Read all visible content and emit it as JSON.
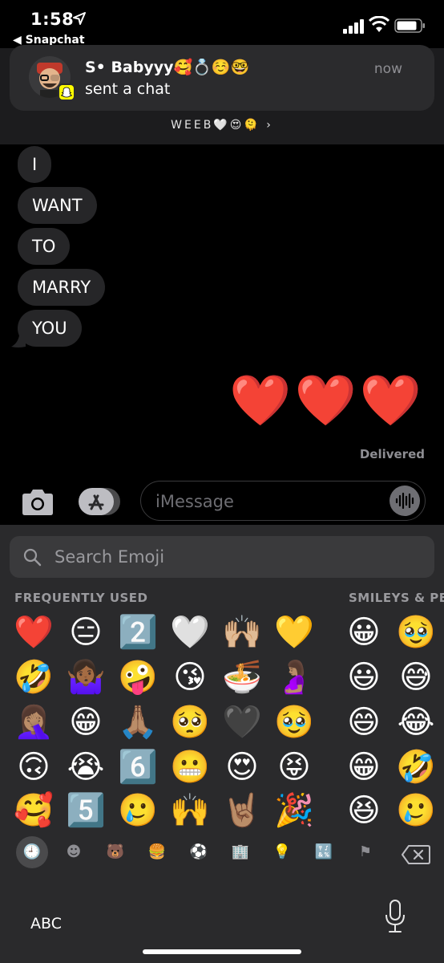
{
  "status": {
    "time": "1:58",
    "back_app": "◀ Snapchat"
  },
  "notification": {
    "title": "S• Babyyy🥰💍☺️🤓",
    "body": "sent a chat",
    "time": "now"
  },
  "conversation": {
    "contact_name": "WEEB🤍😍🫠 ›"
  },
  "messages": [
    "I",
    "WANT",
    "TO",
    "MARRY",
    "YOU"
  ],
  "sent": {
    "hearts": "❤️❤️❤️",
    "status": "Delivered"
  },
  "input": {
    "placeholder": "iMessage"
  },
  "keyboard": {
    "search_placeholder": "Search Emoji",
    "section_frequent": "FREQUENTLY USED",
    "section_smileys": "SMILEYS & PE",
    "frequent": [
      [
        "❤️",
        "😑",
        "2️⃣",
        "🤍",
        "🙌🏼",
        "💛"
      ],
      [
        "🤣",
        "🤷🏾‍♀️",
        "🤪",
        "😘",
        "🍜",
        "🤰🏽"
      ],
      [
        "🤦🏽‍♀️",
        "😁",
        "🙏🏽",
        "🥺",
        "🖤",
        "🥹"
      ],
      [
        "🙃",
        "😭",
        "6️⃣",
        "😬",
        "😍",
        "😝"
      ],
      [
        "🥰",
        "5️⃣",
        "🥲",
        "🙌",
        "🤘🏽",
        "🎉"
      ]
    ],
    "smileys": [
      [
        "😀",
        "🥹"
      ],
      [
        "😃",
        "😅"
      ],
      [
        "😄",
        "😂"
      ],
      [
        "😁",
        "🤣"
      ],
      [
        "😆",
        "🥲"
      ]
    ],
    "categories": [
      "🕘",
      "☻",
      "🐻",
      "🍔",
      "⚽",
      "🏢",
      "💡",
      "🔣",
      "⚑"
    ],
    "abc_label": "ABC"
  }
}
